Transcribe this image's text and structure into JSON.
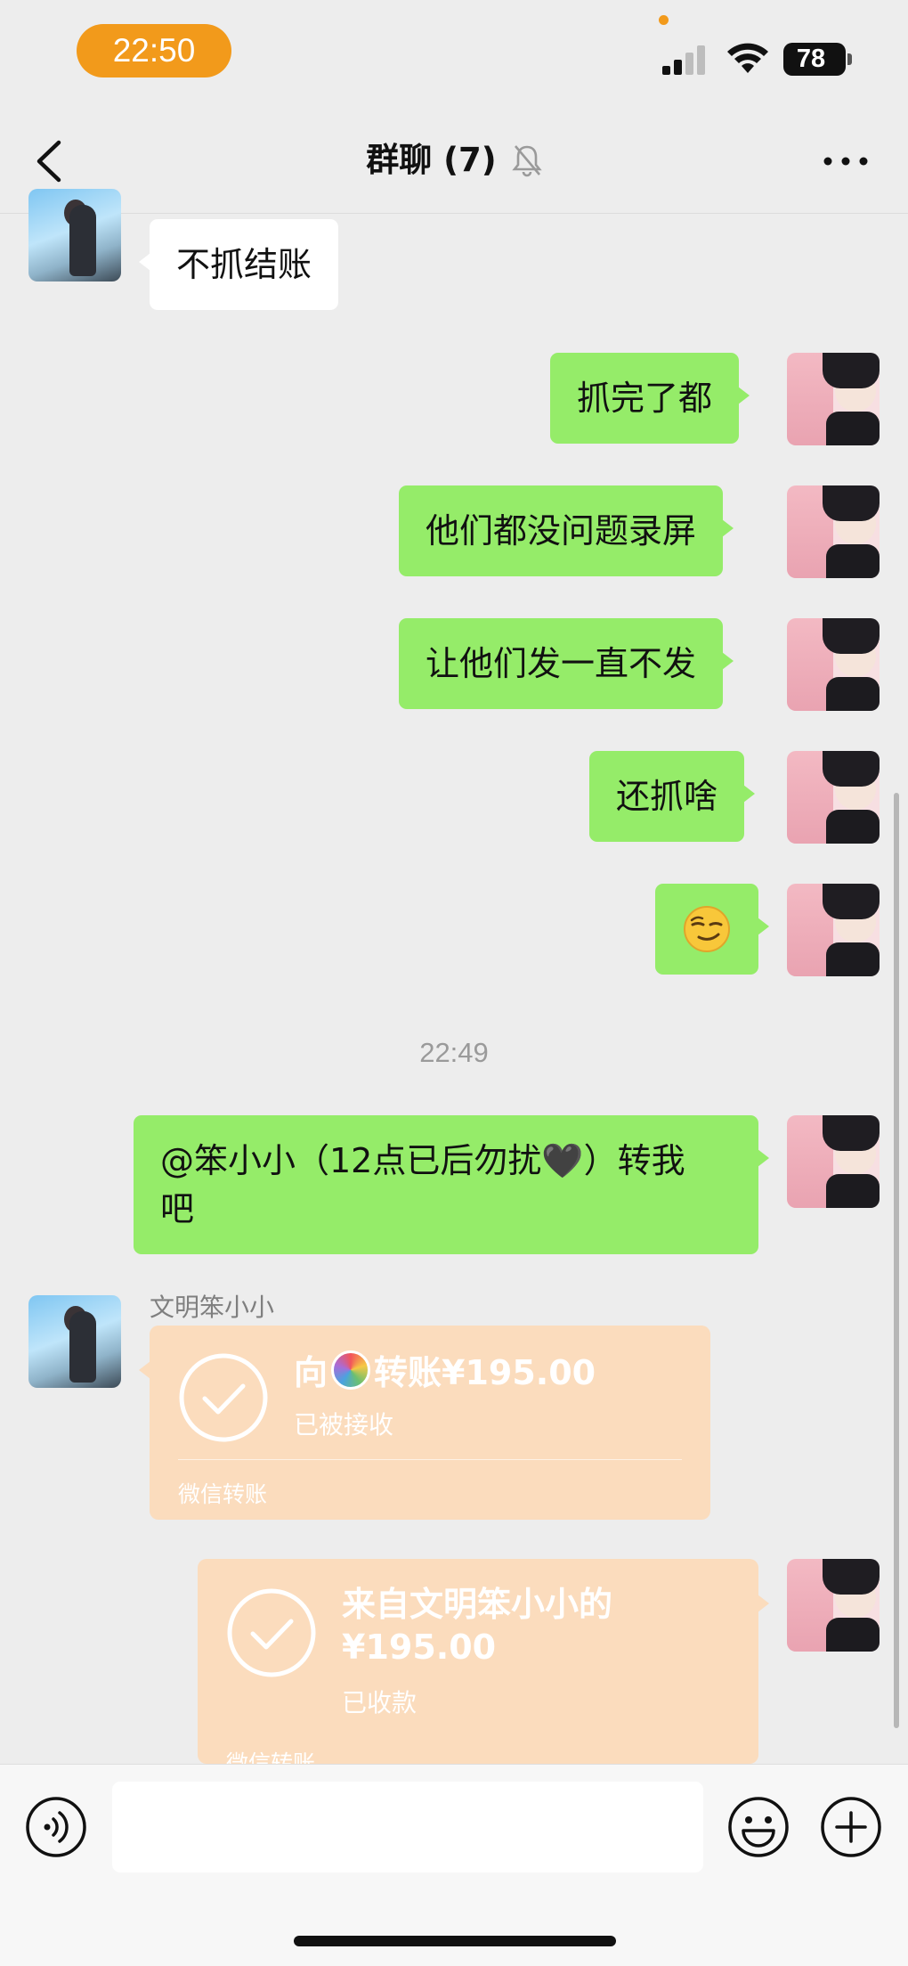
{
  "status_bar": {
    "time": "22:50",
    "battery": "78",
    "icons": [
      "signal-icon",
      "wifi-icon",
      "battery-icon"
    ]
  },
  "nav": {
    "title": "群聊 (7)",
    "icons": [
      "back-icon",
      "mute-bell-icon",
      "more-icon"
    ]
  },
  "messages": [
    {
      "side": "left",
      "text": "不抓结账"
    },
    {
      "side": "right",
      "text": "抓完了都"
    },
    {
      "side": "right",
      "text": "他们都没问题录屏"
    },
    {
      "side": "right",
      "text": "让他们发一直不发"
    },
    {
      "side": "right",
      "text": "还抓啥"
    },
    {
      "side": "right",
      "text": "😏",
      "emoji_name": "smirk-emoji"
    },
    {
      "side": "right",
      "text": "@笨小小（12点已后勿扰🖤）转我吧",
      "line1": "@笨小小（12点已后勿扰🖤）转我",
      "line2": "吧"
    }
  ],
  "timestamp": "22:49",
  "transfer_sent": {
    "sender_name": "文明笨小小",
    "prefix": "向",
    "title": "转账¥195.00",
    "status": "已被接收",
    "footer": "微信转账"
  },
  "transfer_received": {
    "title_line1": "来自文明笨小小的",
    "title_line2": "¥195.00",
    "status": "已收款",
    "footer": "微信转账"
  },
  "input_bar": {
    "placeholder": "",
    "icons": [
      "voice-icon",
      "emoji-icon",
      "plus-icon"
    ]
  },
  "colors": {
    "self_bubble": "#95ec69",
    "other_bubble": "#ffffff",
    "transfer_card": "#fbdcbd",
    "time_pill": "#f29a1b",
    "background": "#ededed"
  }
}
